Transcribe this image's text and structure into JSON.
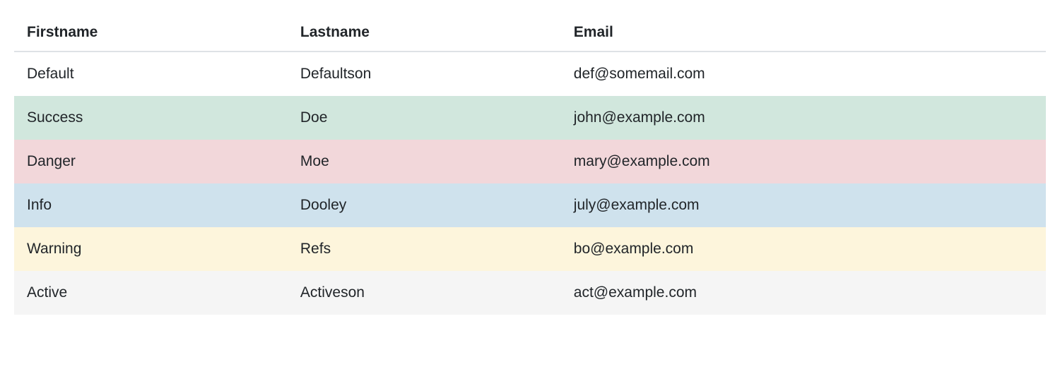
{
  "table": {
    "headers": {
      "firstname": "Firstname",
      "lastname": "Lastname",
      "email": "Email"
    },
    "rows": [
      {
        "variant": "default",
        "firstname": "Default",
        "lastname": "Defaultson",
        "email": "def@somemail.com"
      },
      {
        "variant": "success",
        "firstname": "Success",
        "lastname": "Doe",
        "email": "john@example.com"
      },
      {
        "variant": "danger",
        "firstname": "Danger",
        "lastname": "Moe",
        "email": "mary@example.com"
      },
      {
        "variant": "info",
        "firstname": "Info",
        "lastname": "Dooley",
        "email": "july@example.com"
      },
      {
        "variant": "warning",
        "firstname": "Warning",
        "lastname": "Refs",
        "email": "bo@example.com"
      },
      {
        "variant": "active",
        "firstname": "Active",
        "lastname": "Activeson",
        "email": "act@example.com"
      }
    ]
  }
}
